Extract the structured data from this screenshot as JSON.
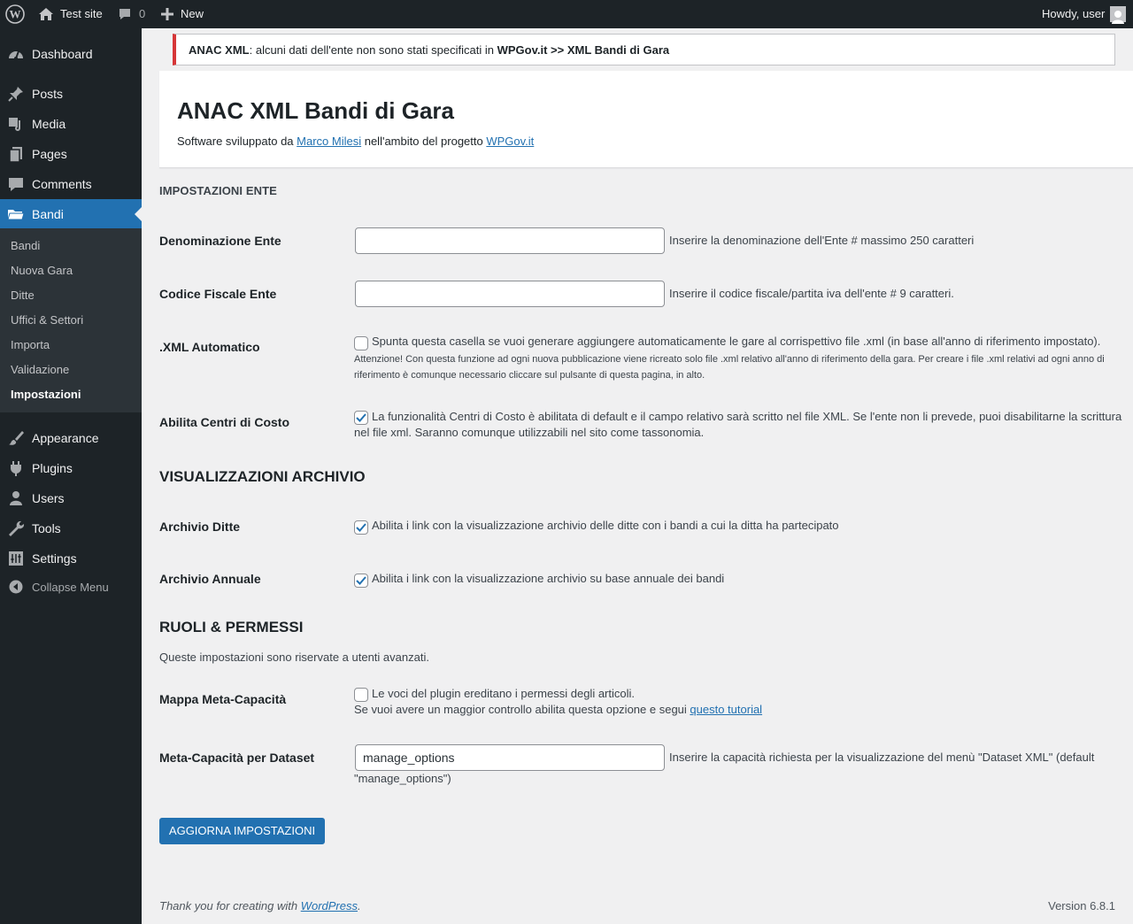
{
  "adminbar": {
    "site_name": "Test site",
    "comments_count": "0",
    "new_label": "New",
    "greeting": "Howdy, user"
  },
  "sidebar": {
    "items": [
      {
        "label": "Dashboard",
        "icon": "dashboard-icon"
      },
      {
        "label": "Posts",
        "icon": "pin-icon"
      },
      {
        "label": "Media",
        "icon": "media-icon"
      },
      {
        "label": "Pages",
        "icon": "pages-icon"
      },
      {
        "label": "Comments",
        "icon": "comment-icon"
      },
      {
        "label": "Bandi",
        "icon": "folder-icon"
      },
      {
        "label": "Appearance",
        "icon": "brush-icon"
      },
      {
        "label": "Plugins",
        "icon": "plugin-icon"
      },
      {
        "label": "Users",
        "icon": "user-icon"
      },
      {
        "label": "Tools",
        "icon": "wrench-icon"
      },
      {
        "label": "Settings",
        "icon": "settings-icon"
      }
    ],
    "submenu": [
      "Bandi",
      "Nuova Gara",
      "Ditte",
      "Uffici & Settori",
      "Importa",
      "Validazione",
      "Impostazioni"
    ],
    "collapse_label": "Collapse Menu"
  },
  "notice": {
    "strong1": "ANAC XML",
    "text": ": alcuni dati dell'ente non sono stati specificati in ",
    "strong2": "WPGov.it >> XML Bandi di Gara"
  },
  "header": {
    "title": "ANAC XML Bandi di Gara",
    "credit_prefix": "Software sviluppato da ",
    "author_link": "Marco Milesi",
    "credit_middle": " nell'ambito del progetto ",
    "project_link": "WPGov.it"
  },
  "settings": {
    "section_ente": "IMPOSTAZIONI ENTE",
    "denominazione_label": "Denominazione Ente",
    "denominazione_value": "",
    "denominazione_desc": "Inserire la denominazione dell'Ente # massimo 250 caratteri",
    "codice_label": "Codice Fiscale Ente",
    "codice_value": "",
    "codice_desc": "Inserire il codice fiscale/partita iva dell'ente # 9 caratteri.",
    "xml_label": ".XML Automatico",
    "xml_checked": false,
    "xml_desc": "Spunta questa casella se vuoi generare aggiungere automaticamente le gare al corrispettivo file .xml (in base all'anno di riferimento impostato).",
    "xml_note": "Attenzione! Con questa funzione ad ogni nuova pubblicazione viene ricreato solo file .xml relativo all'anno di riferimento della gara. Per creare i file .xml relativi ad ogni anno di riferimento è comunque necessario cliccare sul pulsante di questa pagina, in alto.",
    "centri_label": "Abilita Centri di Costo",
    "centri_checked": true,
    "centri_desc_line1": "La funzionalità Centri di Costo è abilitata di default e il campo relativo sarà scritto nel file XML. Se l'ente non li prevede, puoi disabilitarne la scrittura",
    "centri_desc_line2": "nel file xml. Saranno comunque utilizzabili nel sito come tassonomia.",
    "section_archivio": "VISUALIZZAZIONI ARCHIVIO",
    "ditte_label": "Archivio Ditte",
    "ditte_checked": true,
    "ditte_desc": "Abilita i link con la visualizzazione archivio delle ditte con i bandi a cui la ditta ha partecipato",
    "annuale_label": "Archivio Annuale",
    "annuale_checked": true,
    "annuale_desc": "Abilita i link con la visualizzazione archivio su base annuale dei bandi",
    "section_ruoli": "RUOLI & PERMESSI",
    "ruoli_intro": "Queste impostazioni sono riservate a utenti avanzati.",
    "mappa_label": "Mappa Meta-Capacità",
    "mappa_checked": false,
    "mappa_desc": "Le voci del plugin ereditano i permessi degli articoli.",
    "mappa_desc2_prefix": "Se vuoi avere un maggior controllo abilita questa opzione e segui ",
    "mappa_tutorial_link": "questo tutorial",
    "metacap_label": "Meta-Capacità per Dataset",
    "metacap_value": "manage_options",
    "metacap_desc_line1": "Inserire la capacità richiesta per la visualizzazione del menù \"Dataset XML\" (default",
    "metacap_desc_line2": "\"manage_options\")",
    "save_label": "AGGIORNA IMPOSTAZIONI"
  },
  "footer": {
    "thanks_prefix": "Thank you for creating with ",
    "wordpress_link": "WordPress",
    "thanks_suffix": ".",
    "version": "Version 6.8.1"
  },
  "colors": {
    "admin_dark": "#1d2327",
    "accent": "#2271b1",
    "notice_error": "#d63638"
  }
}
